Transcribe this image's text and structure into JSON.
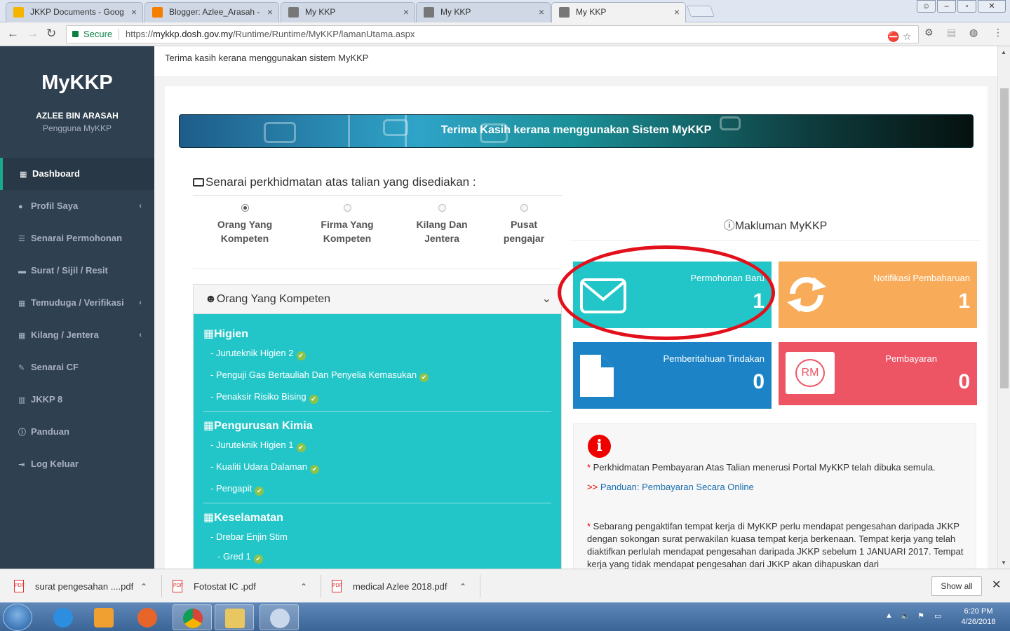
{
  "browser": {
    "tabs": [
      {
        "title": "JKKP Documents - Goog",
        "favicon_color": "#f4b400"
      },
      {
        "title": "Blogger: Azlee_Arasah -",
        "favicon_color": "#f57d00"
      },
      {
        "title": "My KKP",
        "favicon_color": "#666666"
      },
      {
        "title": "My KKP",
        "favicon_color": "#666666"
      },
      {
        "title": "My KKP",
        "favicon_color": "#666666"
      }
    ],
    "secure_label": "Secure",
    "url_prefix": "https://",
    "url_host": "mykkp.dosh.gov.my",
    "url_path": "/Runtime/Runtime/MyKKP/lamanUtama.aspx"
  },
  "sidebar": {
    "brand": "MyKKP",
    "user_name": "AZLEE BIN ARASAH",
    "user_role": "Pengguna MyKKP",
    "items": [
      {
        "label": "Dashboard",
        "icon": "grid-icon"
      },
      {
        "label": "Profil Saya",
        "icon": "user-icon"
      },
      {
        "label": "Senarai Permohonan",
        "icon": "list-icon"
      },
      {
        "label": "Surat / Sijil / Resit",
        "icon": "folder-icon"
      },
      {
        "label": "Temuduga / Verifikasi",
        "icon": "calendar-icon"
      },
      {
        "label": "Kilang / Jentera",
        "icon": "calendar-icon"
      },
      {
        "label": "Senarai CF",
        "icon": "edit-icon"
      },
      {
        "label": "JKKP 8",
        "icon": "chart-icon"
      },
      {
        "label": "Panduan",
        "icon": "info-icon"
      },
      {
        "label": "Log Keluar",
        "icon": "sign-out-icon"
      }
    ]
  },
  "topline": "Terima kasih kerana menggunakan sistem MyKKP",
  "banner": "Terima Kasih kerana menggunakan Sistem MyKKP",
  "services": {
    "title": "Senarai perkhidmatan atas talian yang disediakan :",
    "options": [
      {
        "line1": "Orang Yang",
        "line2": "Kompeten"
      },
      {
        "line1": "Firma Yang",
        "line2": "Kompeten"
      },
      {
        "line1": "Kilang Dan",
        "line2": "Jentera"
      },
      {
        "line1": "Pusat",
        "line2": "pengajar"
      }
    ],
    "selected": "Orang Yang Kompeten"
  },
  "ok_panel": {
    "title": "Orang Yang Kompeten",
    "sections": [
      {
        "title": "Higien",
        "items": [
          "- Juruteknik Higien 2",
          "- Penguji Gas Bertauliah Dan Penyelia Kemasukan",
          "- Penaksir Risiko Bising"
        ]
      },
      {
        "title": "Pengurusan Kimia",
        "items": [
          "- Juruteknik Higien 1",
          "- Kualiti Udara Dalaman",
          "- Pengapit"
        ]
      },
      {
        "title": "Keselamatan",
        "items": [
          "- Drebar Enjin Stim",
          "- Gred 1"
        ]
      }
    ]
  },
  "makluman": {
    "title": "Makluman MyKKP",
    "tiles": [
      {
        "label": "Permohonan Baru",
        "value": "1",
        "color": "#23c6c8",
        "icon": "envelope-icon"
      },
      {
        "label": "Notifikasi Pembaharuan",
        "value": "1",
        "color": "#f8ac59",
        "icon": "refresh-icon"
      },
      {
        "label": "Pemberitahuan Tindakan",
        "value": "0",
        "color": "#1c84c6",
        "icon": "file-icon"
      },
      {
        "label": "Pembayaran",
        "value": "0",
        "color": "#ed5565",
        "icon": "money-icon",
        "icon_text": "RM"
      }
    ],
    "info_icon": "i",
    "notice1": "Perkhidmatan Pembayaran Atas Talian menerusi Portal MyKKP telah dibuka semula.",
    "link_prefix": ">>",
    "link": "Panduan: Pembayaran Secara Online",
    "notice2": "Sebarang pengaktifan tempat kerja di MyKKP perlu mendapat pengesahan daripada JKKP dengan sokongan surat perwakilan kuasa tempat kerja berkenaan. Tempat kerja yang telah diaktifkan perlulah mendapat pengesahan daripada JKKP sebelum 1 JANUARI 2017. Tempat kerja yang tidak mendapat pengesahan dari JKKP akan dihapuskan dari"
  },
  "downloads": {
    "items": [
      "surat pengesahan ....pdf",
      "Fotostat IC .pdf",
      "medical Azlee 2018.pdf"
    ],
    "show_all": "Show all"
  },
  "taskbar": {
    "time": "6:20 PM",
    "date": "4/26/2018"
  },
  "colors": {
    "sidebar_bg": "#2f4050",
    "accent": "#19aa8d",
    "annotation": "#e2101b"
  }
}
